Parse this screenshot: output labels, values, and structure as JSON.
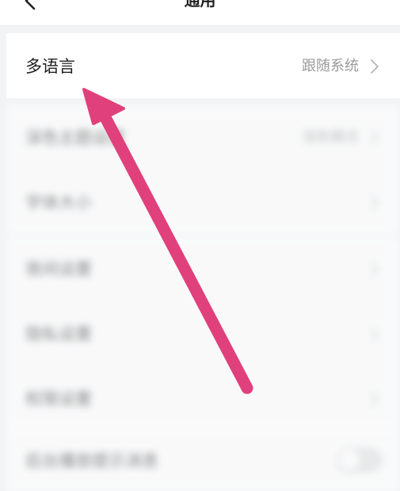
{
  "header": {
    "title": "通用",
    "back_icon": "chevron-left-icon"
  },
  "language_row": {
    "label": "多语言",
    "value": "跟随系统",
    "chevron_icon": "chevron-right-icon"
  },
  "blurred_section_1": {
    "rows": [
      {
        "label": "深色主题设置",
        "value": "浅色模式"
      },
      {
        "label": "字体大小",
        "value": ""
      }
    ]
  },
  "blurred_section_2": {
    "rows": [
      {
        "label": "夜间设置",
        "value": ""
      },
      {
        "label": "隐私设置",
        "value": ""
      },
      {
        "label": "权限设置",
        "value": ""
      }
    ]
  },
  "blurred_section_3": {
    "rows": [
      {
        "label": "后台播放提示消息",
        "toggle": false
      }
    ]
  },
  "annotation": {
    "arrow_color": "#e0407b"
  },
  "colors": {
    "background": "#f2f3f5",
    "card": "#ffffff",
    "value_text": "#9a9a9a"
  }
}
